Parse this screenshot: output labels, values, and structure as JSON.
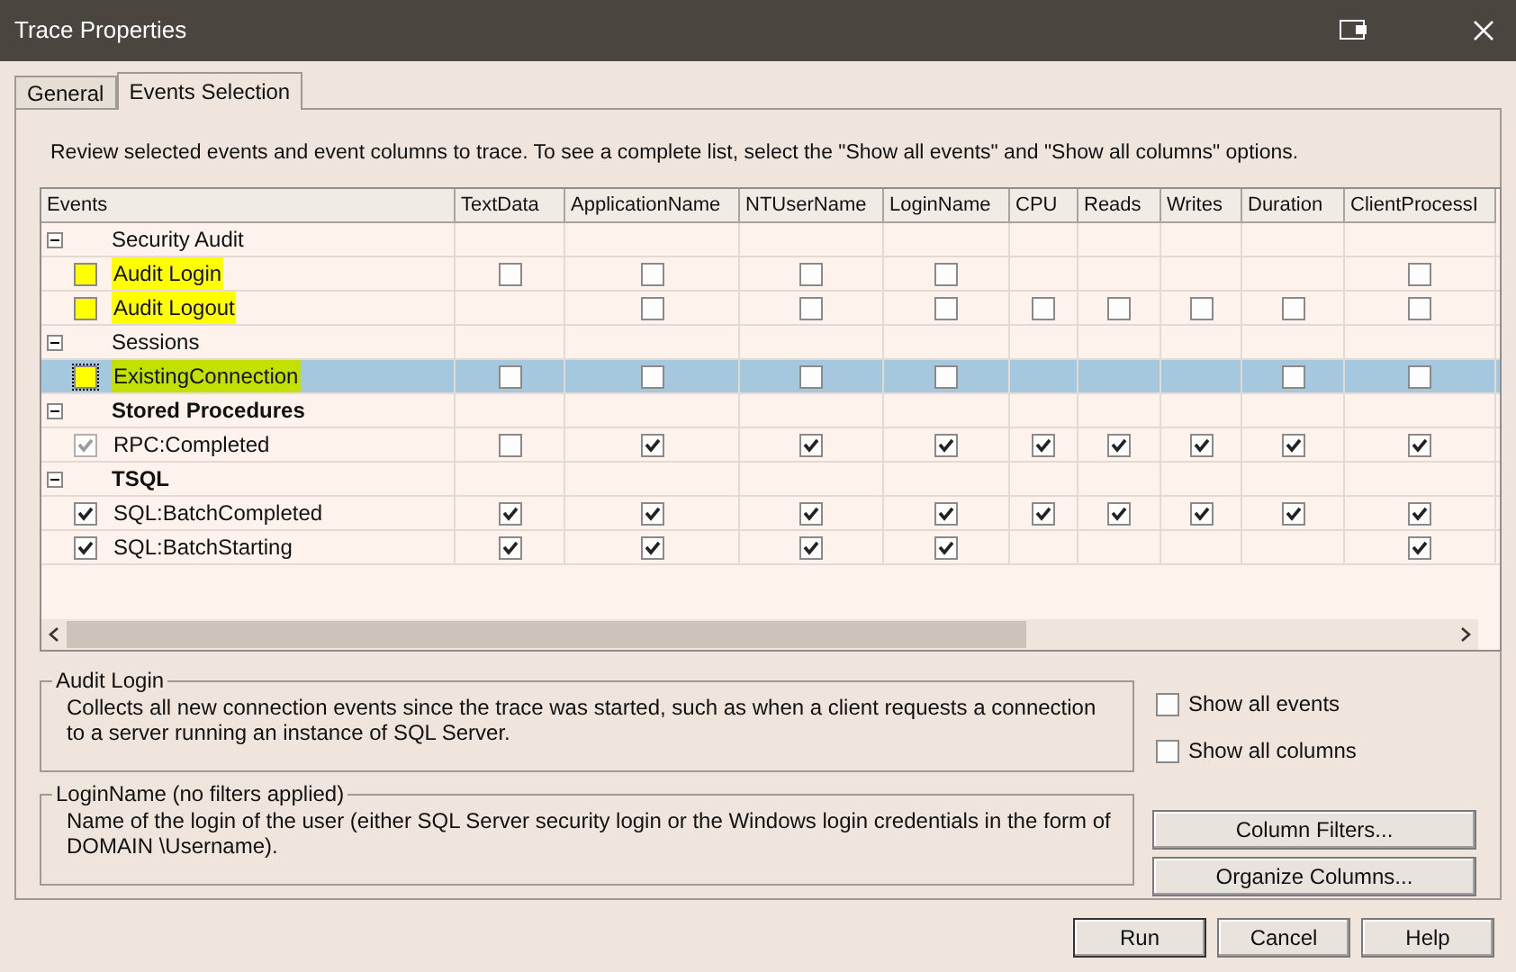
{
  "window": {
    "title": "Trace Properties"
  },
  "tabs": [
    {
      "label": "General",
      "selected": false
    },
    {
      "label": "Events Selection",
      "selected": true
    }
  ],
  "instructions": "Review selected events and event columns to trace. To see a complete list, select the \"Show all events\" and \"Show all columns\" options.",
  "table": {
    "columns": [
      "Events",
      "TextData",
      "ApplicationName",
      "NTUserName",
      "LoginName",
      "CPU",
      "Reads",
      "Writes",
      "Duration",
      "ClientProcessI"
    ],
    "rows": [
      {
        "kind": "category",
        "label": "Security Audit",
        "expanded": true,
        "bold": false
      },
      {
        "kind": "event",
        "label": "Audit Login",
        "checked": false,
        "disabled": false,
        "highlighted": true,
        "selected": false,
        "cells": [
          {
            "kind": "checkbox",
            "checked": false
          },
          {
            "kind": "checkbox",
            "checked": false
          },
          {
            "kind": "checkbox",
            "checked": false
          },
          {
            "kind": "checkbox",
            "checked": false
          },
          {
            "kind": "empty"
          },
          {
            "kind": "empty"
          },
          {
            "kind": "empty"
          },
          {
            "kind": "empty"
          },
          {
            "kind": "checkbox",
            "checked": false
          }
        ]
      },
      {
        "kind": "event",
        "label": "Audit Logout",
        "checked": false,
        "disabled": false,
        "highlighted": true,
        "selected": false,
        "cells": [
          {
            "kind": "empty"
          },
          {
            "kind": "checkbox",
            "checked": false
          },
          {
            "kind": "checkbox",
            "checked": false
          },
          {
            "kind": "checkbox",
            "checked": false
          },
          {
            "kind": "checkbox",
            "checked": false
          },
          {
            "kind": "checkbox",
            "checked": false
          },
          {
            "kind": "checkbox",
            "checked": false
          },
          {
            "kind": "checkbox",
            "checked": false
          },
          {
            "kind": "checkbox",
            "checked": false
          }
        ]
      },
      {
        "kind": "category",
        "label": "Sessions",
        "expanded": true,
        "bold": false
      },
      {
        "kind": "event",
        "label": "ExistingConnection",
        "checked": false,
        "disabled": false,
        "highlighted": true,
        "selected": true,
        "cells": [
          {
            "kind": "checkbox",
            "checked": false
          },
          {
            "kind": "checkbox",
            "checked": false
          },
          {
            "kind": "checkbox",
            "checked": false
          },
          {
            "kind": "checkbox",
            "checked": false
          },
          {
            "kind": "empty"
          },
          {
            "kind": "empty"
          },
          {
            "kind": "empty"
          },
          {
            "kind": "checkbox",
            "checked": false
          },
          {
            "kind": "checkbox",
            "checked": false
          }
        ]
      },
      {
        "kind": "category",
        "label": "Stored Procedures",
        "expanded": true,
        "bold": true
      },
      {
        "kind": "event",
        "label": "RPC:Completed",
        "checked": true,
        "disabled": true,
        "highlighted": false,
        "selected": false,
        "cells": [
          {
            "kind": "checkbox",
            "checked": false
          },
          {
            "kind": "checkbox",
            "checked": true
          },
          {
            "kind": "checkbox",
            "checked": true
          },
          {
            "kind": "checkbox",
            "checked": true
          },
          {
            "kind": "checkbox",
            "checked": true
          },
          {
            "kind": "checkbox",
            "checked": true
          },
          {
            "kind": "checkbox",
            "checked": true
          },
          {
            "kind": "checkbox",
            "checked": true
          },
          {
            "kind": "checkbox",
            "checked": true
          }
        ]
      },
      {
        "kind": "category",
        "label": "TSQL",
        "expanded": true,
        "bold": true
      },
      {
        "kind": "event",
        "label": "SQL:BatchCompleted",
        "checked": true,
        "disabled": false,
        "highlighted": false,
        "selected": false,
        "cells": [
          {
            "kind": "checkbox",
            "checked": true
          },
          {
            "kind": "checkbox",
            "checked": true
          },
          {
            "kind": "checkbox",
            "checked": true
          },
          {
            "kind": "checkbox",
            "checked": true
          },
          {
            "kind": "checkbox",
            "checked": true
          },
          {
            "kind": "checkbox",
            "checked": true
          },
          {
            "kind": "checkbox",
            "checked": true
          },
          {
            "kind": "checkbox",
            "checked": true
          },
          {
            "kind": "checkbox",
            "checked": true
          }
        ]
      },
      {
        "kind": "event",
        "label": "SQL:BatchStarting",
        "checked": true,
        "disabled": false,
        "highlighted": false,
        "selected": false,
        "cells": [
          {
            "kind": "checkbox",
            "checked": true
          },
          {
            "kind": "checkbox",
            "checked": true
          },
          {
            "kind": "checkbox",
            "checked": true
          },
          {
            "kind": "checkbox",
            "checked": true
          },
          {
            "kind": "empty"
          },
          {
            "kind": "empty"
          },
          {
            "kind": "empty"
          },
          {
            "kind": "empty"
          },
          {
            "kind": "checkbox",
            "checked": true
          }
        ]
      }
    ]
  },
  "event_description": {
    "title": "Audit Login",
    "text": "Collects all new connection events since the trace was started, such as when a client requests a connection to a server running an instance of SQL Server."
  },
  "options": [
    {
      "label": "Show all events",
      "checked": false
    },
    {
      "label": "Show all columns",
      "checked": false
    }
  ],
  "column_description": {
    "title": "LoginName (no filters applied)",
    "text": "Name of the login of the user (either SQL Server security login or the Windows login credentials in the form of DOMAIN \\Username)."
  },
  "side_buttons": [
    "Column Filters...",
    "Organize Columns..."
  ],
  "buttons": [
    "Run",
    "Cancel",
    "Help"
  ]
}
